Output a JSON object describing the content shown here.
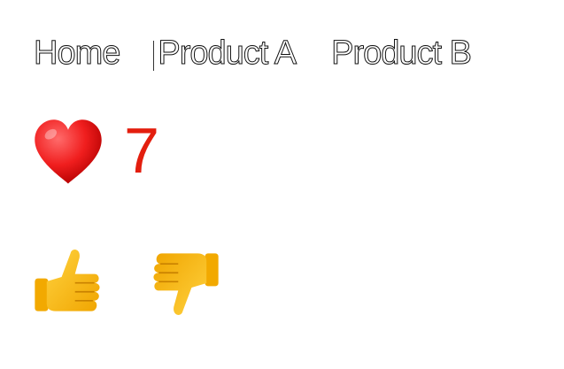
{
  "nav": {
    "items": [
      {
        "label": "Home"
      },
      {
        "label": "Product A"
      },
      {
        "label": "Product B"
      }
    ]
  },
  "likes": {
    "icon": "heart-icon",
    "count": "7",
    "count_color": "#e31e0e"
  },
  "votes": {
    "up_icon": "thumbs-up-icon",
    "down_icon": "thumbs-down-icon"
  }
}
